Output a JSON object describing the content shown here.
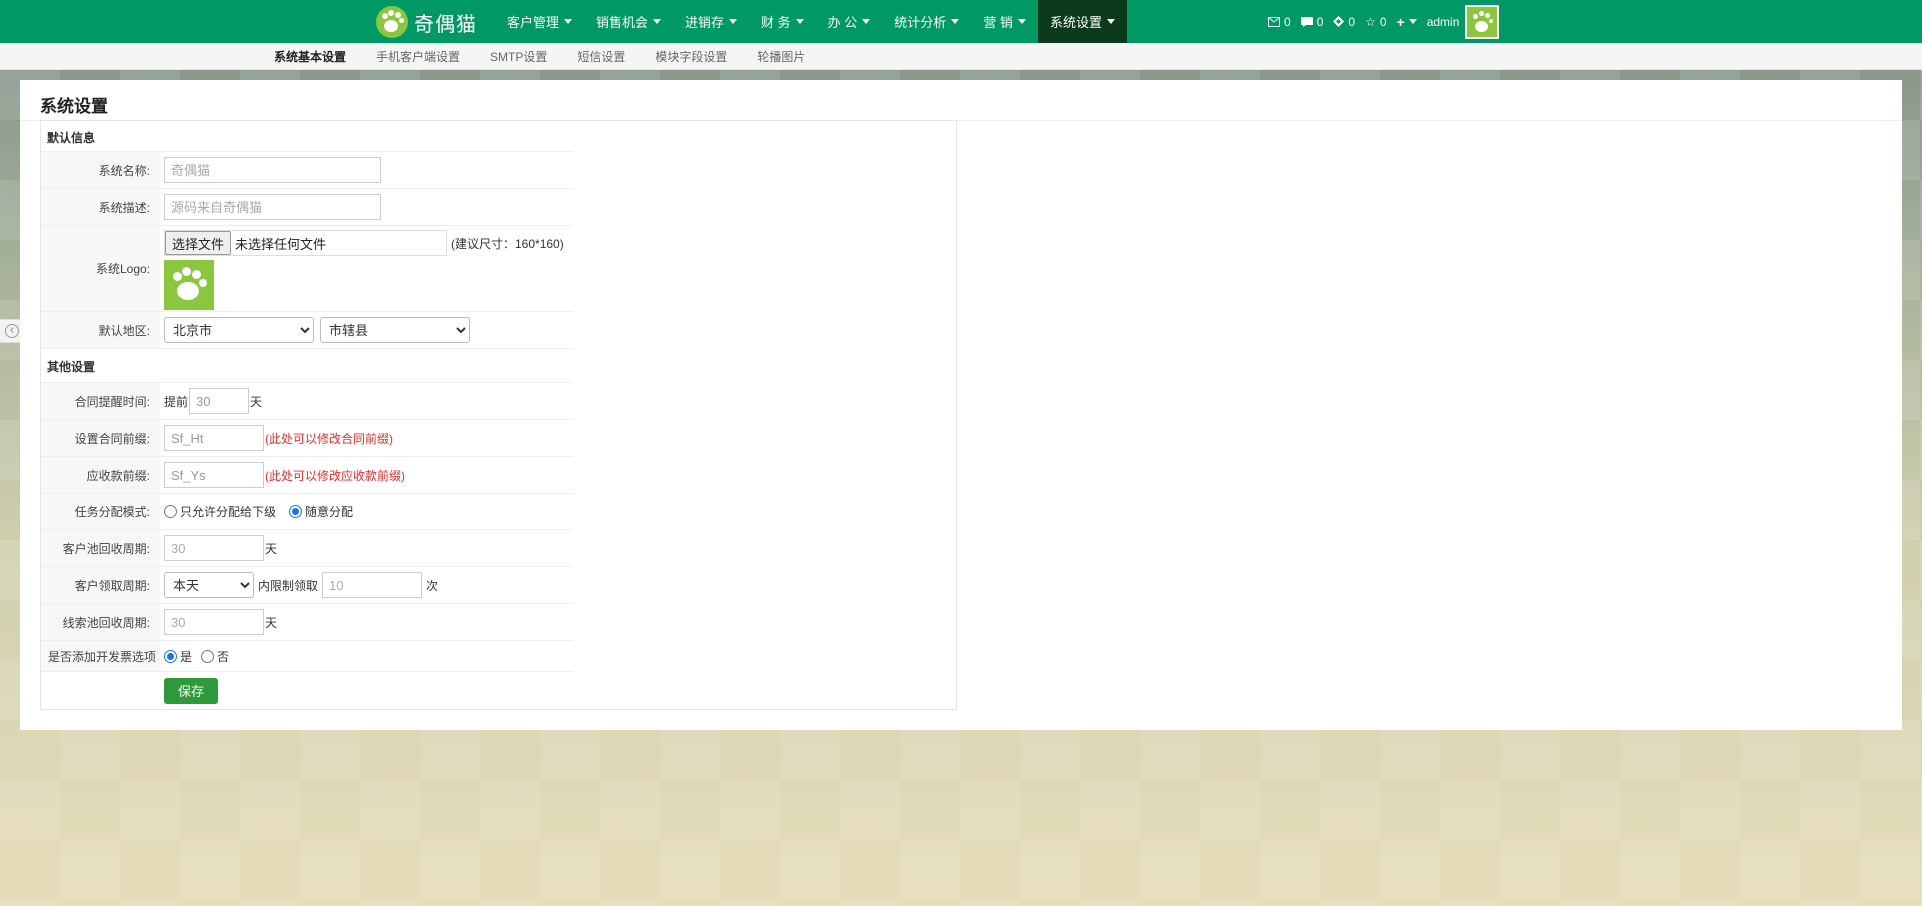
{
  "brand": {
    "name": "奇偶猫"
  },
  "nav": {
    "items": [
      {
        "label": "客户管理"
      },
      {
        "label": "销售机会"
      },
      {
        "label": "进销存"
      },
      {
        "label": "财 务"
      },
      {
        "label": "办 公"
      },
      {
        "label": "统计分析"
      },
      {
        "label": "营 销"
      },
      {
        "label": "系统设置"
      }
    ],
    "active_index": 7,
    "counters": {
      "mail": "0",
      "message": "0",
      "task": "0",
      "favorite": "0"
    },
    "user": "admin"
  },
  "subnav": {
    "items": [
      {
        "label": "系统基本设置"
      },
      {
        "label": "手机客户端设置"
      },
      {
        "label": "SMTP设置"
      },
      {
        "label": "短信设置"
      },
      {
        "label": "模块字段设置"
      },
      {
        "label": "轮播图片"
      }
    ],
    "active_index": 0
  },
  "page": {
    "title": "系统设置"
  },
  "section_default": {
    "title": "默认信息",
    "system_name": {
      "label": "系统名称:",
      "placeholder": "奇偶猫"
    },
    "system_desc": {
      "label": "系统描述:",
      "placeholder": "源码来自奇偶猫"
    },
    "logo": {
      "label": "系统Logo:",
      "button": "选择文件",
      "no_file": "未选择任何文件",
      "hint": "(建议尺寸：160*160)"
    },
    "region": {
      "label": "默认地区:",
      "province": "北京市",
      "district": "市辖县"
    }
  },
  "section_other": {
    "title": "其他设置",
    "contract_remind": {
      "label": "合同提醒时间:",
      "prefix": "提前",
      "value": "30",
      "unit": "天"
    },
    "contract_prefix": {
      "label": "设置合同前缀:",
      "value": "Sf_Ht",
      "hint": "(此处可以修改合同前缀)"
    },
    "receivable_prefix": {
      "label": "应收款前缀:",
      "value": "Sf_Ys",
      "hint": "(此处可以修改应收款前缀)"
    },
    "task_mode": {
      "label": "任务分配模式:",
      "option_1": "只允许分配给下级",
      "option_2": "随意分配",
      "selected": 2
    },
    "customer_pool": {
      "label": "客户池回收周期:",
      "value": "30",
      "unit": "天"
    },
    "claim_cycle": {
      "label": "客户领取周期:",
      "period": "本天",
      "middle": "内限制领取",
      "limit": "10",
      "unit": "次"
    },
    "lead_pool": {
      "label": "线索池回收周期:",
      "value": "30",
      "unit": "天"
    },
    "invoice_option": {
      "label": "是否添加开发票选项",
      "yes": "是",
      "no": "否",
      "selected": "yes"
    },
    "save": "保存"
  },
  "colors": {
    "navbar": "#009966",
    "active_nav": "#0c3a1c",
    "save_button": "#2e9a3b",
    "hint_red": "#e03030",
    "brand_logo": "#8cc63f"
  }
}
